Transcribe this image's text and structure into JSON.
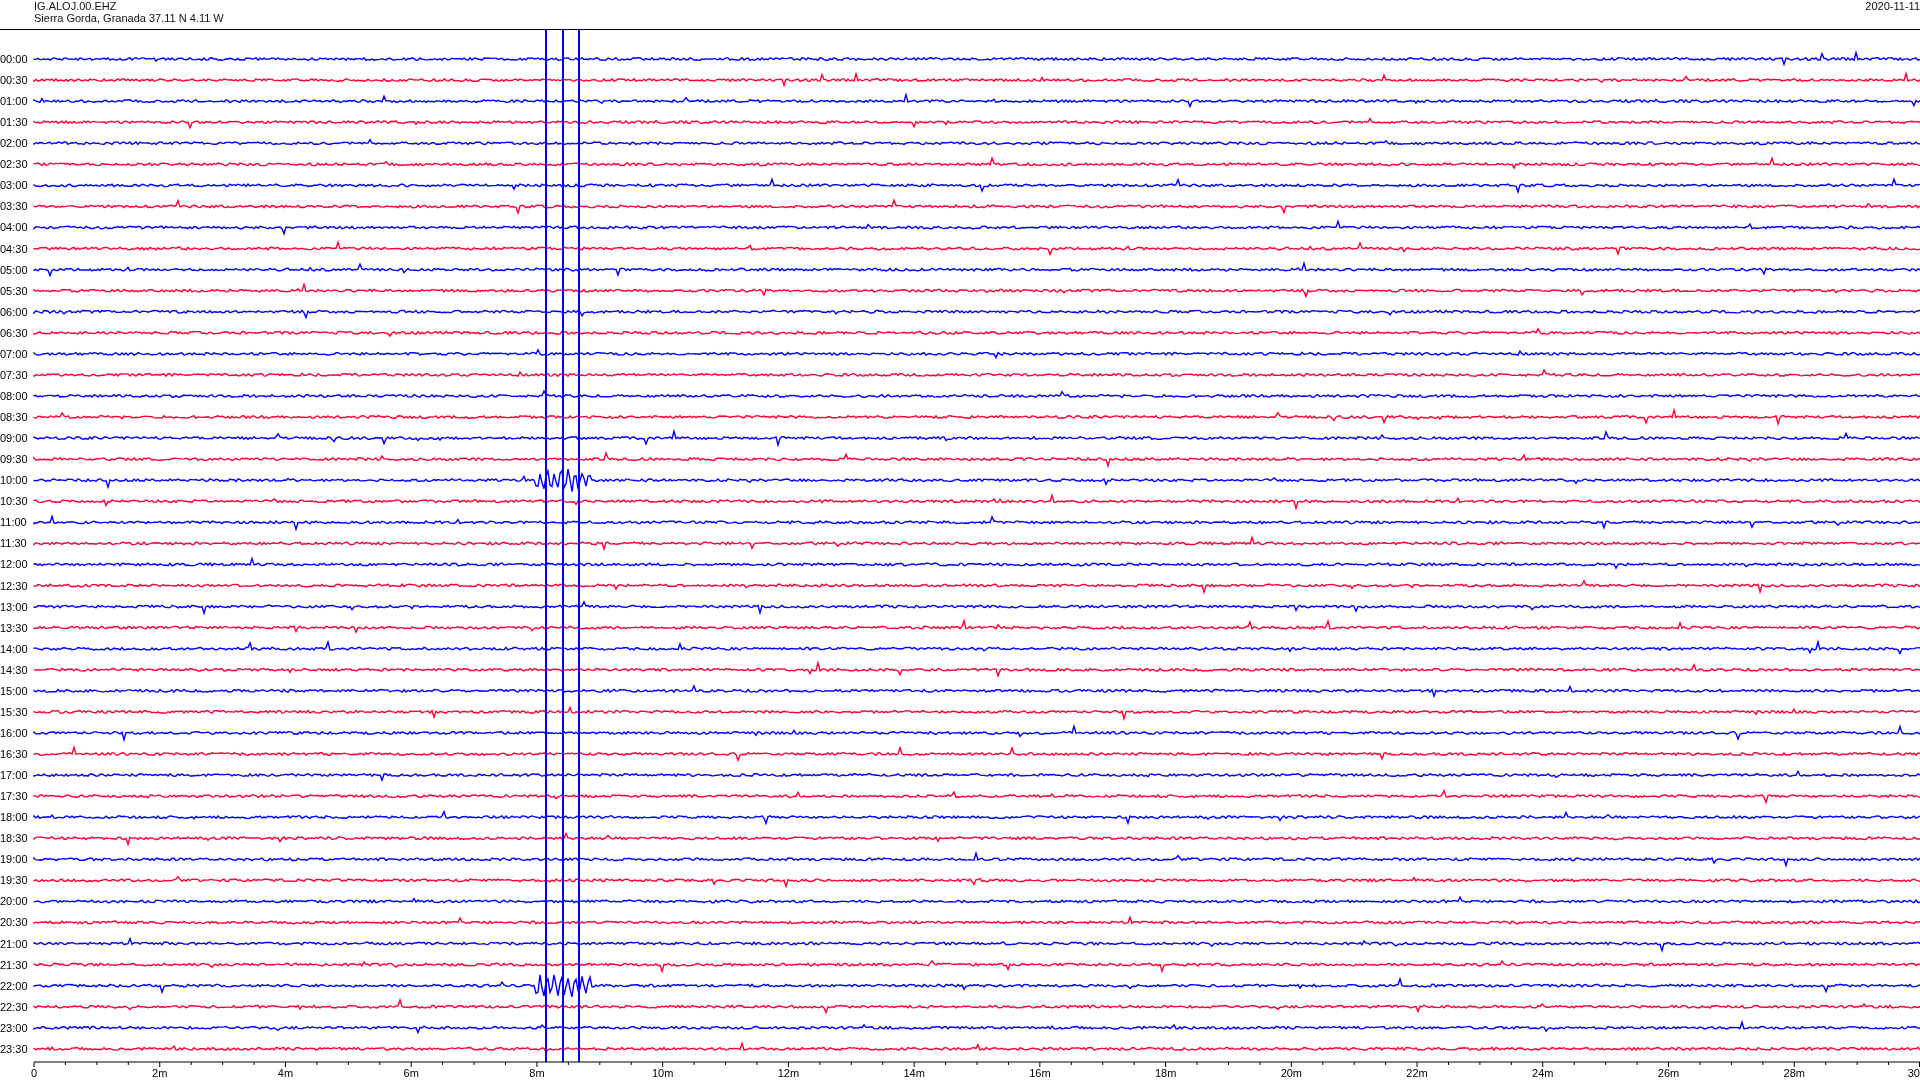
{
  "header": {
    "station": "IG.ALOJ.00.EHZ",
    "location": "Sierra Gorda, Granada  37.11 N 4.11 W",
    "date": "2020-11-11"
  },
  "rows": [
    {
      "time": "00:00",
      "color": "#0000ff"
    },
    {
      "time": "00:30",
      "color": "#ff0033"
    },
    {
      "time": "01:00",
      "color": "#0000ff"
    },
    {
      "time": "01:30",
      "color": "#ff0033"
    },
    {
      "time": "02:00",
      "color": "#0000ff"
    },
    {
      "time": "02:30",
      "color": "#ff0033"
    },
    {
      "time": "03:00",
      "color": "#0000ff"
    },
    {
      "time": "03:30",
      "color": "#ff0033"
    },
    {
      "time": "04:00",
      "color": "#0000ff"
    },
    {
      "time": "04:30",
      "color": "#ff0033"
    },
    {
      "time": "05:00",
      "color": "#0000ff"
    },
    {
      "time": "05:30",
      "color": "#ff0033"
    },
    {
      "time": "06:00",
      "color": "#0000ff"
    },
    {
      "time": "06:30",
      "color": "#ff0033"
    },
    {
      "time": "07:00",
      "color": "#0000ff"
    },
    {
      "time": "07:30",
      "color": "#ff0033"
    },
    {
      "time": "08:00",
      "color": "#0000ff"
    },
    {
      "time": "08:30",
      "color": "#ff0033"
    },
    {
      "time": "09:00",
      "color": "#0000ff"
    },
    {
      "time": "09:30",
      "color": "#ff0033"
    },
    {
      "time": "10:00",
      "color": "#0000ff"
    },
    {
      "time": "10:30",
      "color": "#ff0033"
    },
    {
      "time": "11:00",
      "color": "#0000ff"
    },
    {
      "time": "11:30",
      "color": "#ff0033"
    },
    {
      "time": "12:00",
      "color": "#0000ff"
    },
    {
      "time": "12:30",
      "color": "#ff0033"
    },
    {
      "time": "13:00",
      "color": "#0000ff"
    },
    {
      "time": "13:30",
      "color": "#ff0033"
    },
    {
      "time": "14:00",
      "color": "#0000ff"
    },
    {
      "time": "14:30",
      "color": "#ff0033"
    },
    {
      "time": "15:00",
      "color": "#0000ff"
    },
    {
      "time": "15:30",
      "color": "#ff0033"
    },
    {
      "time": "16:00",
      "color": "#0000ff"
    },
    {
      "time": "16:30",
      "color": "#ff0033"
    },
    {
      "time": "17:00",
      "color": "#0000ff"
    },
    {
      "time": "17:30",
      "color": "#ff0033"
    },
    {
      "time": "18:00",
      "color": "#0000ff"
    },
    {
      "time": "18:30",
      "color": "#ff0033"
    },
    {
      "time": "19:00",
      "color": "#0000ff"
    },
    {
      "time": "19:30",
      "color": "#ff0033"
    },
    {
      "time": "20:00",
      "color": "#0000ff"
    },
    {
      "time": "20:30",
      "color": "#ff0033"
    },
    {
      "time": "21:00",
      "color": "#0000ff"
    },
    {
      "time": "21:30",
      "color": "#ff0033"
    },
    {
      "time": "22:00",
      "color": "#0000ff"
    },
    {
      "time": "22:30",
      "color": "#ff0033"
    },
    {
      "time": "23:00",
      "color": "#0000ff"
    },
    {
      "time": "23:30",
      "color": "#ff0033"
    }
  ],
  "axis": {
    "ticks": [
      "0",
      "2m",
      "4m",
      "6m",
      "8m",
      "10m",
      "12m",
      "14m",
      "16m",
      "18m",
      "20m",
      "22m",
      "24m",
      "26m",
      "28m",
      "30"
    ]
  }
}
